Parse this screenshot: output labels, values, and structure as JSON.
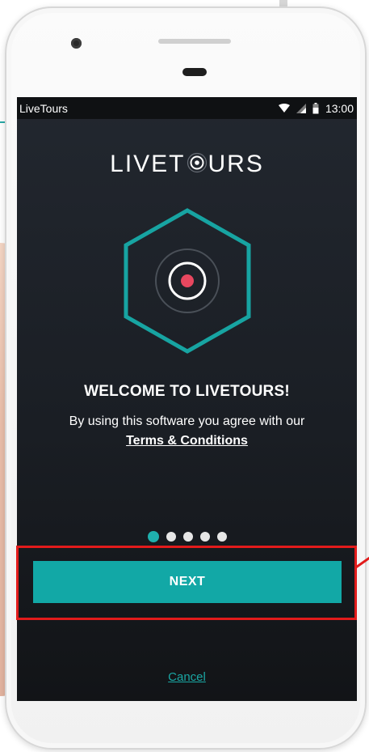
{
  "status_bar": {
    "app_name": "LiveTours",
    "time": "13:00"
  },
  "brand": {
    "text_before": "LIVET",
    "text_after": "URS"
  },
  "welcome": {
    "title": "WELCOME TO LIVETOURS!",
    "agree_text": "By using this software you agree with our",
    "terms_label": "Terms & Conditions"
  },
  "pager": {
    "total": 5,
    "current": 1
  },
  "actions": {
    "next_label": "NEXT",
    "cancel_label": "Cancel"
  },
  "colors": {
    "accent": "#12a8a6",
    "record_dot": "#e8475f",
    "highlight": "#e21b1b",
    "background": "#1a1e24"
  },
  "icons": {
    "wifi": "wifi-icon",
    "signal": "signal-icon",
    "battery": "battery-icon",
    "logo": "hexagon-record-logo-icon"
  }
}
